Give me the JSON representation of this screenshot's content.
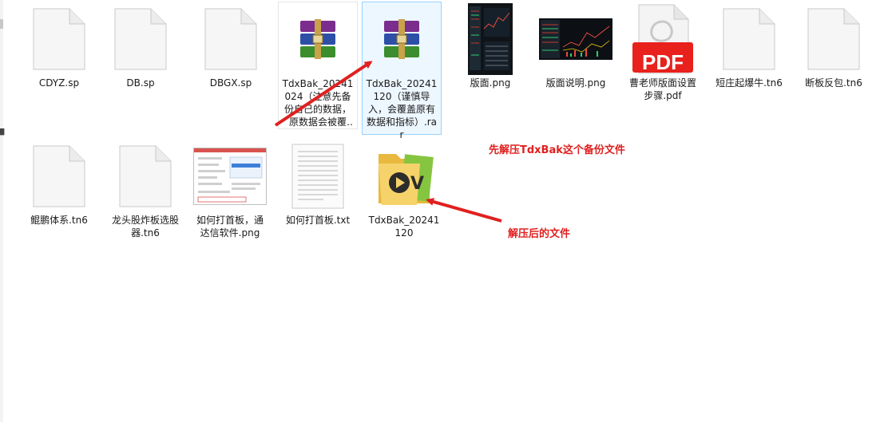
{
  "files_row1": [
    {
      "name": "CDYZ.sp",
      "icon": "blank-document-icon"
    },
    {
      "name": "DB.sp",
      "icon": "blank-document-icon"
    },
    {
      "name": "DBGX.sp",
      "icon": "blank-document-icon"
    },
    {
      "name": "TdxBak_20241024（注意先备份自己的数据，原数据会被覆盖...",
      "icon": "winrar-archive-icon"
    },
    {
      "name": "TdxBak_20241120（谨慎导入，会覆盖原有数据和指标）.rar",
      "icon": "winrar-archive-icon"
    },
    {
      "name": "版面.png",
      "icon": "image-thumbnail-icon"
    },
    {
      "name": "版面说明.png",
      "icon": "image-thumbnail-icon"
    },
    {
      "name": "曹老师版面设置步骤.pdf",
      "icon": "pdf-icon",
      "badge": "PDF"
    },
    {
      "name": "短庄起爆牛.tn6",
      "icon": "blank-document-icon"
    },
    {
      "name": "断板反包.tn6",
      "icon": "blank-document-icon"
    }
  ],
  "files_row2": [
    {
      "name": "鲲鹏体系.tn6",
      "icon": "blank-document-icon"
    },
    {
      "name": "龙头股炸板选股器.tn6",
      "icon": "blank-document-icon"
    },
    {
      "name": "如何打首板，通达信软件.png",
      "icon": "image-thumbnail-icon"
    },
    {
      "name": "如何打首板.txt",
      "icon": "text-document-icon"
    },
    {
      "name": "TdxBak_20241120",
      "icon": "folder-icon"
    }
  ],
  "annotations": {
    "extract_first": "先解压TdxBak这个备份文件",
    "after_extract": "解压后的文件"
  },
  "colors": {
    "annotation_red": "#e02020",
    "selection_border": "#99d1ff",
    "pdf_red": "#e8211c"
  }
}
